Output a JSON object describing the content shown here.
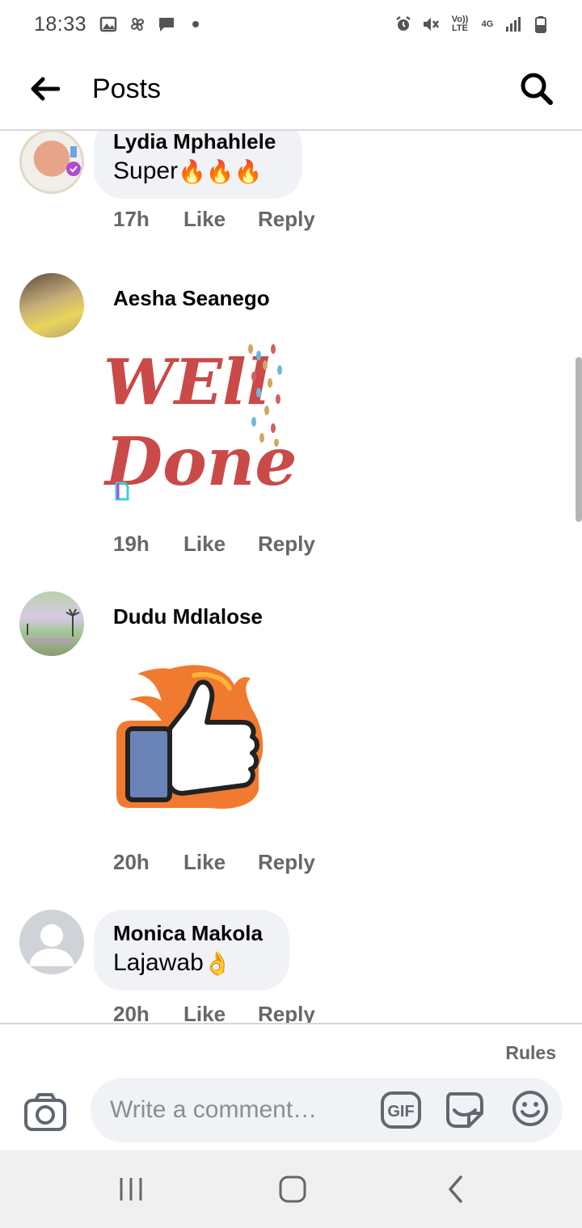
{
  "status_bar": {
    "time": "18:33",
    "left_icons": [
      "image-icon",
      "pinwheel-icon",
      "chat-icon",
      "dot-icon"
    ],
    "right_icons": [
      "alarm-icon",
      "mute-icon",
      "volte-icon",
      "4g-icon",
      "signal-icon",
      "battery-icon"
    ],
    "volte_label": "Vo)) LTE",
    "network_label": "4G"
  },
  "header": {
    "title": "Posts"
  },
  "comments": [
    {
      "author": "Lydia Mphahlele",
      "text": "Super",
      "emoji": "🔥🔥🔥",
      "time": "17h",
      "like": "Like",
      "reply": "Reply"
    },
    {
      "author": "Aesha Seanego",
      "sticker": "well-done-sticker",
      "sticker_text_1": "WEll",
      "sticker_text_2": "Done",
      "time": "19h",
      "like": "Like",
      "reply": "Reply"
    },
    {
      "author": "Dudu Mdlalose",
      "sticker": "thumbs-up-fire-sticker",
      "time": "20h",
      "like": "Like",
      "reply": "Reply"
    },
    {
      "author": "Monica Makola",
      "text": "Lajawab",
      "emoji": "👌",
      "time": "20h",
      "like": "Like",
      "reply": "Reply"
    }
  ],
  "composer": {
    "rules": "Rules",
    "placeholder": "Write a comment…",
    "gif_label": "GIF"
  },
  "colors": {
    "bubble": "#f0f2f5",
    "meta": "#65676b",
    "text": "#050505"
  }
}
